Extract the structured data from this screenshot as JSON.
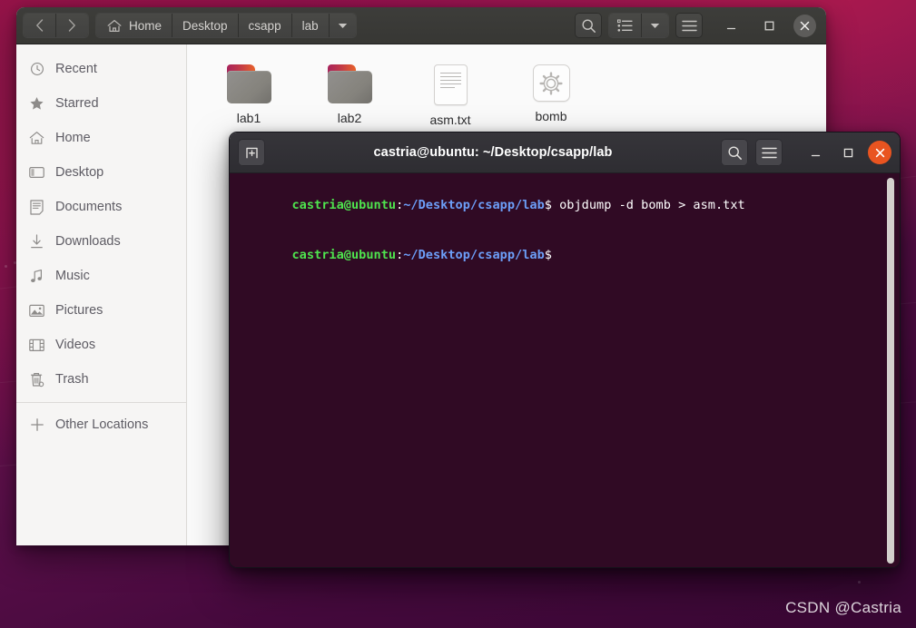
{
  "desktop": {
    "watermark": "CSDN @Castria",
    "wallpaper_colors": {
      "top_right": "#b01a4e",
      "mid": "#7c1050",
      "bottom": "#380733"
    }
  },
  "file_manager": {
    "nav": {
      "back_icon": "chevron-left-icon",
      "forward_icon": "chevron-right-icon"
    },
    "breadcrumbs": [
      {
        "label": "Home",
        "icon": "home-icon"
      },
      {
        "label": "Desktop",
        "icon": ""
      },
      {
        "label": "csapp",
        "icon": ""
      },
      {
        "label": "lab",
        "icon": ""
      }
    ],
    "breadcrumb_dropdown_icon": "chevron-down-icon",
    "toolbar": {
      "search_icon": "search-icon",
      "view_list_icon": "list-view-icon",
      "view_dropdown_icon": "chevron-down-icon",
      "menu_icon": "hamburger-menu-icon",
      "minimize_icon": "minimize-icon",
      "maximize_icon": "maximize-icon",
      "close_icon": "close-icon"
    },
    "sidebar": {
      "items": [
        {
          "label": "Recent",
          "icon": "clock-icon"
        },
        {
          "label": "Starred",
          "icon": "star-icon"
        },
        {
          "label": "Home",
          "icon": "home-icon"
        },
        {
          "label": "Desktop",
          "icon": "desktop-icon"
        },
        {
          "label": "Documents",
          "icon": "document-icon"
        },
        {
          "label": "Downloads",
          "icon": "download-icon"
        },
        {
          "label": "Music",
          "icon": "music-note-icon"
        },
        {
          "label": "Pictures",
          "icon": "picture-icon"
        },
        {
          "label": "Videos",
          "icon": "film-icon"
        },
        {
          "label": "Trash",
          "icon": "trash-icon"
        }
      ],
      "other_locations": {
        "label": "Other Locations",
        "icon": "plus-icon"
      }
    },
    "files": [
      {
        "name": "lab1",
        "type": "folder"
      },
      {
        "name": "lab2",
        "type": "folder"
      },
      {
        "name": "asm.txt",
        "type": "text-document"
      },
      {
        "name": "bomb",
        "type": "executable"
      }
    ]
  },
  "terminal": {
    "title": "castria@ubuntu: ~/Desktop/csapp/lab",
    "new_tab_icon": "new-tab-icon",
    "search_icon": "search-icon",
    "menu_icon": "hamburger-menu-icon",
    "minimize_icon": "minimize-icon",
    "maximize_icon": "maximize-icon",
    "close_icon": "close-icon",
    "background_color": "#300a24",
    "lines": [
      {
        "user": "castria@ubuntu",
        "colon": ":",
        "path": "~/Desktop/csapp/lab",
        "prompt": "$",
        "command": " objdump -d bomb > asm.txt"
      },
      {
        "user": "castria@ubuntu",
        "colon": ":",
        "path": "~/Desktop/csapp/lab",
        "prompt": "$",
        "command": ""
      }
    ]
  }
}
